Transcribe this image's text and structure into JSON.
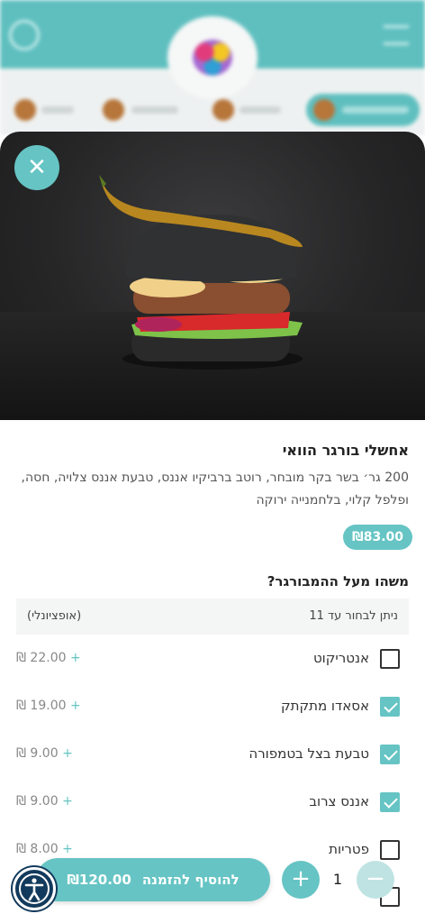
{
  "item": {
    "title": "אחשלי בורגר הוואי",
    "description": "200 גר׳ בשר בקר מובחר, רוטב ברביקיו אננס, טבעת אננס צלויה, חסה, ופלפל קלוי, בלחמנייה ירוקה",
    "price": "₪83.00"
  },
  "options_section": {
    "title": "משהו מעל ההמבורגר?",
    "hint": "ניתן לבחור עד 11",
    "optional_label": "(אופציונלי)",
    "options": [
      {
        "name": "אנטריקוט",
        "price": "₪ 22.00",
        "checked": false
      },
      {
        "name": "אסאדו מתקתק",
        "price": "₪ 19.00",
        "checked": true
      },
      {
        "name": "טבעת בצל בטמפורה",
        "price": "₪ 9.00",
        "checked": true
      },
      {
        "name": "אננס צרוב",
        "price": "₪ 9.00",
        "checked": true
      },
      {
        "name": "פטריות",
        "price": "₪ 8.00",
        "checked": false
      }
    ]
  },
  "footer": {
    "add_label": "להוסיף להזמנה",
    "total": "₪120.00",
    "quantity": "1",
    "plus_symbol": "+",
    "minus_symbol": "−"
  },
  "close_symbol": "✕",
  "plus_symbol": "+",
  "colors": {
    "accent": "#66c4c4",
    "dark_navy": "#123a5c"
  }
}
